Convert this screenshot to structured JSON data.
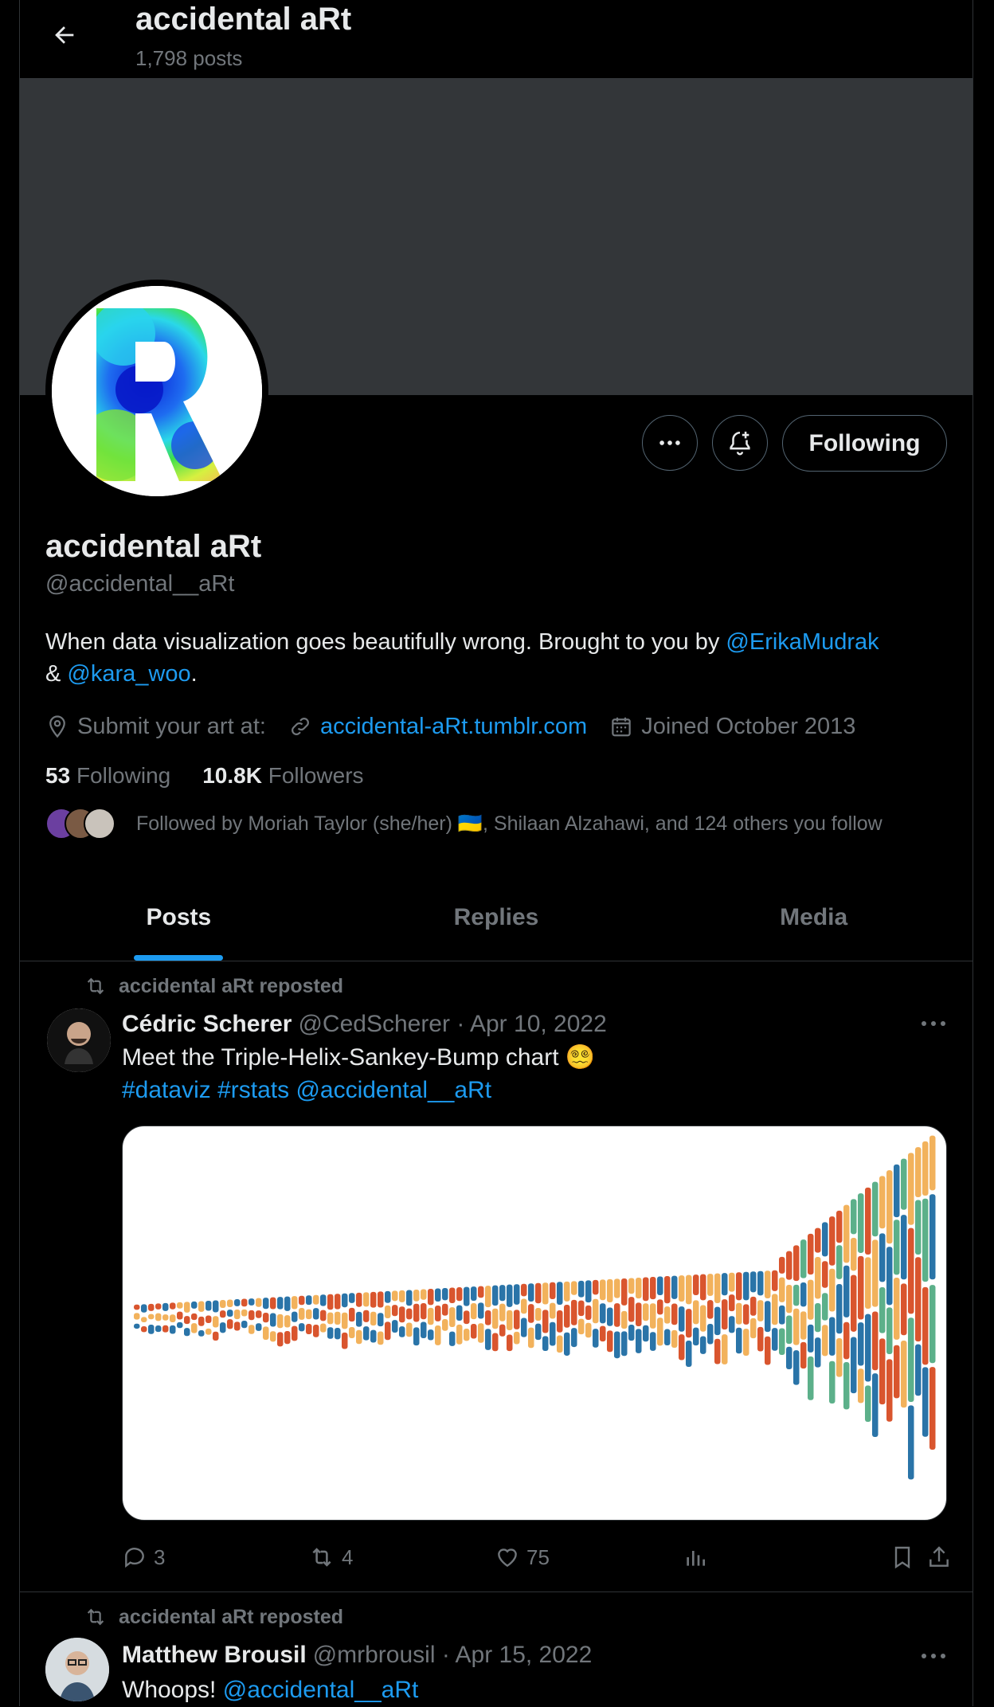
{
  "header": {
    "title": "accidental aRt",
    "post_count": "1,798 posts"
  },
  "profile": {
    "name": "accidental aRt",
    "handle": "@accidental__aRt",
    "bio_text": "When data visualization goes beautifully wrong.  Brought to you by ",
    "bio_mention1": "@ErikaMudrak",
    "bio_amp": "& ",
    "bio_mention2": "@kara_woo",
    "bio_end": ".",
    "location": "Submit your art at:",
    "website": "accidental-aRt.tumblr.com",
    "joined": "Joined October 2013",
    "following_count": "53",
    "following_label": "Following",
    "followers_count": "10.8K",
    "followers_label": "Followers",
    "followed_by": "Followed by Moriah Taylor (she/her) 🇺🇦, Shilaan Alzahawi, and 124 others you follow",
    "follow_button": "Following"
  },
  "tabs": [
    {
      "label": "Posts",
      "active": true
    },
    {
      "label": "Replies",
      "active": false
    },
    {
      "label": "Media",
      "active": false
    }
  ],
  "tweets": [
    {
      "repost_label": "accidental aRt reposted",
      "author": "Cédric Scherer",
      "handle": "@CedScherer · Apr 10, 2022",
      "text": "Meet the Triple-Helix-Sankey-Bump chart 😵‍💫",
      "tags": "#dataviz #rstats @accidental__aRt",
      "replies": "3",
      "reposts": "4",
      "likes": "75"
    },
    {
      "repost_label": "accidental aRt reposted",
      "author": "Matthew Brousil",
      "handle": "@mrbrousil · Apr 15, 2022",
      "text_start": "Whoops! ",
      "text_mention": "@accidental__aRt"
    }
  ],
  "colors": {
    "accent": "#1d9bf0",
    "banner": "#333639",
    "muted": "#71767b",
    "orange": "#f2b25c",
    "red": "#d9552e",
    "blue": "#2a74a8",
    "green": "#5cb08a"
  }
}
